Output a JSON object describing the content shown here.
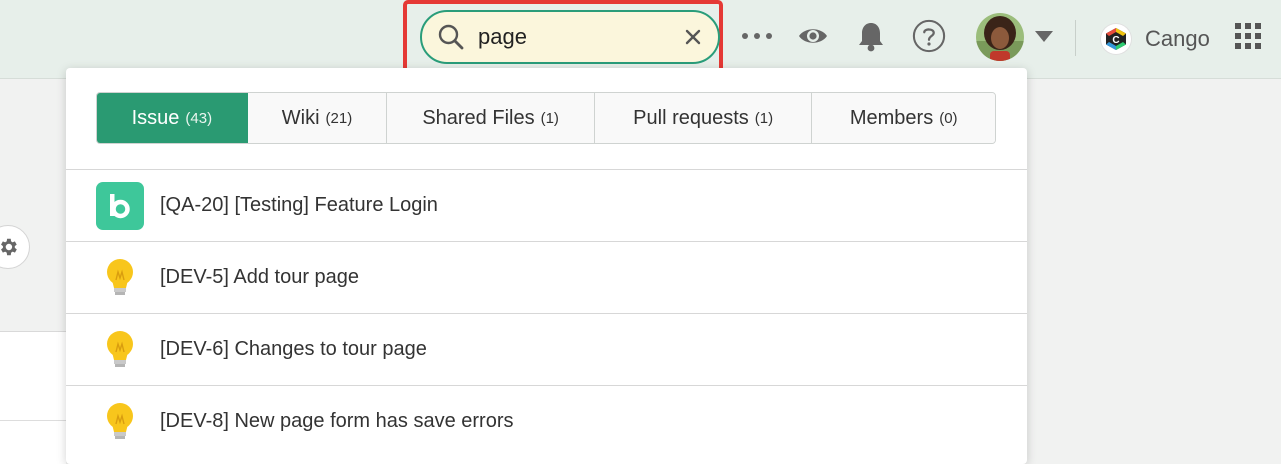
{
  "header": {
    "search": {
      "value": "page",
      "placeholder": ""
    },
    "brand_name": "Cango"
  },
  "tabs": [
    {
      "label": "Issue",
      "count": "(43)",
      "active": true
    },
    {
      "label": "Wiki",
      "count": "(21)",
      "active": false
    },
    {
      "label": "Shared Files",
      "count": "(1)",
      "active": false
    },
    {
      "label": "Pull requests",
      "count": "(1)",
      "active": false
    },
    {
      "label": "Members",
      "count": "(0)",
      "active": false
    }
  ],
  "results": [
    {
      "icon": "backlog-logo-icon",
      "text": "[QA-20] [Testing] Feature Login"
    },
    {
      "icon": "lightbulb-icon",
      "text": "[DEV-5] Add tour page"
    },
    {
      "icon": "lightbulb-icon",
      "text": "[DEV-6] Changes to tour page"
    },
    {
      "icon": "lightbulb-icon",
      "text": "[DEV-8] New page form has save errors"
    }
  ],
  "colors": {
    "accent": "#2a9a72",
    "highlight": "#e53935",
    "search_bg": "#fbf6dc",
    "bulb": "#f8c61c"
  }
}
